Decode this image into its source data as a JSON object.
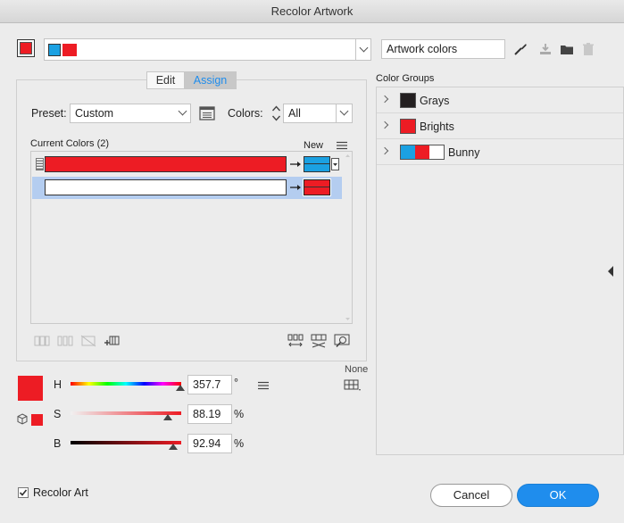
{
  "window": {
    "title": "Recolor Artwork"
  },
  "colors": {
    "red": "#ed1c24",
    "blue": "#1ba1e2",
    "white": "#ffffff",
    "black": "#231f20",
    "accent": "#1f8ded",
    "selected_row": "#b4cdf0"
  },
  "top": {
    "harmony_name": "Artwork colors",
    "icons": [
      "eyedropper-icon",
      "save-color-group-icon",
      "folder-icon",
      "trash-icon"
    ]
  },
  "tabs": [
    {
      "label": "Edit",
      "active": false
    },
    {
      "label": "Assign",
      "active": true
    }
  ],
  "assign": {
    "preset_label": "Preset:",
    "preset_value": "Custom",
    "colors_label": "Colors:",
    "colors_value": "All",
    "current_colors_label": "Current Colors (2)",
    "new_label": "New",
    "rows": [
      {
        "current": "#ed1c24",
        "new": "#1ba1e2",
        "selected": false
      },
      {
        "current": "#ffffff",
        "new": "#ed1c24",
        "selected": true
      }
    ]
  },
  "sliders": {
    "none_label": "None",
    "h": {
      "label": "H",
      "value": "357.7",
      "unit": "°",
      "level": 0.994
    },
    "s": {
      "label": "S",
      "value": "88.19",
      "unit": "%",
      "level": 0.8819
    },
    "b": {
      "label": "B",
      "value": "92.94",
      "unit": "%",
      "level": 0.9294
    }
  },
  "color_groups": {
    "heading": "Color Groups",
    "groups": [
      {
        "name": "Grays",
        "swatches": [
          "#231f20"
        ]
      },
      {
        "name": "Brights",
        "swatches": [
          "#ed1c24"
        ]
      },
      {
        "name": "Bunny",
        "swatches": [
          "#1ba1e2",
          "#ed1c24",
          "#ffffff"
        ]
      }
    ]
  },
  "footer": {
    "recolor_art_label": "Recolor Art",
    "recolor_art_checked": true,
    "cancel_label": "Cancel",
    "ok_label": "OK"
  }
}
